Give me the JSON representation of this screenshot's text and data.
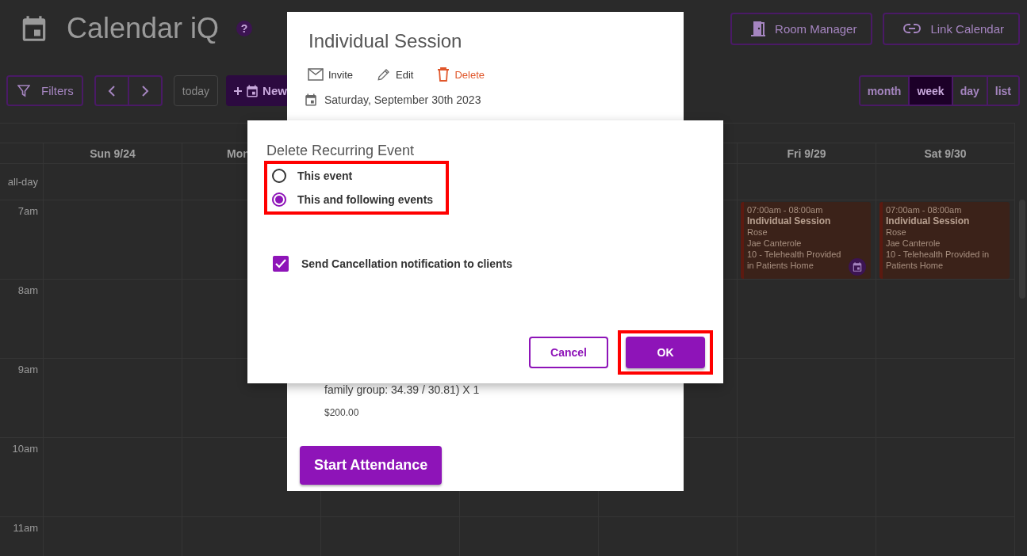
{
  "header": {
    "title": "Calendar iQ",
    "help": "?",
    "buttons": [
      {
        "label": "Room Manager"
      },
      {
        "label": "Link Calendar"
      }
    ]
  },
  "toolbar": {
    "filters": "Filters",
    "today": {
      "label": "today",
      "disabled": true
    },
    "new_button": "New"
  },
  "views": [
    {
      "label": "month",
      "selected": false
    },
    {
      "label": "week",
      "selected": true
    },
    {
      "label": "day",
      "selected": false
    },
    {
      "label": "list",
      "selected": false
    }
  ],
  "calendar": {
    "days": [
      {
        "label": "Sun 9/24",
        "partly_hidden": false
      },
      {
        "label": "Mon",
        "partly_hidden": true
      },
      {
        "label": "Fri 9/29",
        "partly_hidden": false
      },
      {
        "label": "Sat 9/30",
        "partly_hidden": false
      }
    ],
    "all_day_label": "all-day",
    "hours": [
      "7am",
      "8am",
      "9am",
      "10am",
      "11am"
    ],
    "events": [
      {
        "time": "07:00am - 08:00am",
        "title": "Individual Session",
        "lines": [
          "Rose",
          "Jae Canterole",
          "10 - Telehealth Provided in Patients Home"
        ],
        "badge": true
      },
      {
        "time": "07:00am - 08:00am",
        "title": "Individual Session",
        "lines": [
          "Rose",
          "Jae Canterole",
          "10 - Telehealth Provided in Patients Home"
        ],
        "badge": false
      }
    ]
  },
  "event_modal": {
    "title": "Individual Session",
    "actions": [
      {
        "label": "Invite",
        "kind": "invite"
      },
      {
        "label": "Edit",
        "kind": "edit"
      },
      {
        "label": "Delete",
        "kind": "delete"
      }
    ],
    "date": "Saturday, September 30th 2023",
    "detail": "family group: 34.39 / 30.81) X 1",
    "price": "$200.00",
    "primary_button": "Start Attendance"
  },
  "dialog": {
    "title": "Delete Recurring Event",
    "options_highlighted": true,
    "options": [
      {
        "label": "This event",
        "selected": false
      },
      {
        "label": "This and following events",
        "selected": true
      }
    ],
    "notify": {
      "label": "Send Cancellation notification to clients",
      "checked": true
    },
    "buttons": [
      {
        "label": "Cancel",
        "kind": "secondary",
        "highlighted": false
      },
      {
        "label": "OK",
        "kind": "primary",
        "highlighted": true
      }
    ]
  }
}
